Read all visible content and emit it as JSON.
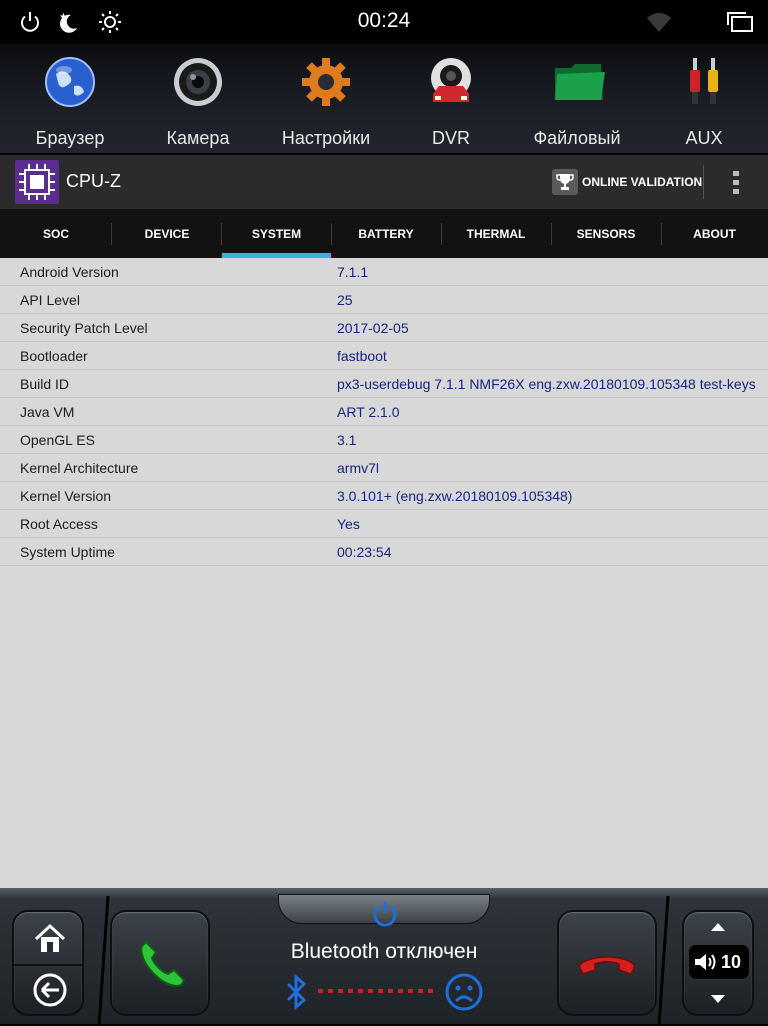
{
  "status_bar": {
    "time": "00:24",
    "icons": [
      "power-icon",
      "night-mode-icon",
      "brightness-icon",
      "wifi-icon",
      "recent-apps-icon"
    ]
  },
  "dock": {
    "apps": [
      {
        "label": "Браузер",
        "icon": "globe-icon"
      },
      {
        "label": "Камера",
        "icon": "camera-icon"
      },
      {
        "label": "Настройки",
        "icon": "gear-icon"
      },
      {
        "label": "DVR",
        "icon": "dvr-icon"
      },
      {
        "label": "Файловый",
        "icon": "folder-icon"
      },
      {
        "label": "AUX",
        "icon": "aux-icon"
      }
    ]
  },
  "app": {
    "title": "CPU-Z",
    "validation_label": "ONLINE VALIDATION",
    "accent": "#33b5e5",
    "logo_color": "#5b2d8e"
  },
  "tabs": [
    {
      "label": "SOC",
      "active": false
    },
    {
      "label": "DEVICE",
      "active": false
    },
    {
      "label": "SYSTEM",
      "active": true
    },
    {
      "label": "BATTERY",
      "active": false
    },
    {
      "label": "THERMAL",
      "active": false
    },
    {
      "label": "SENSORS",
      "active": false
    },
    {
      "label": "ABOUT",
      "active": false
    }
  ],
  "system_info": [
    {
      "key": "Android Version",
      "value": "7.1.1"
    },
    {
      "key": "API Level",
      "value": "25"
    },
    {
      "key": "Security Patch Level",
      "value": "2017-02-05"
    },
    {
      "key": "Bootloader",
      "value": "fastboot"
    },
    {
      "key": "Build ID",
      "value": "px3-userdebug 7.1.1 NMF26X eng.zxw.20180109.105348 test-keys"
    },
    {
      "key": "Java VM",
      "value": "ART 2.1.0"
    },
    {
      "key": "OpenGL ES",
      "value": "3.1"
    },
    {
      "key": "Kernel Architecture",
      "value": "armv7l"
    },
    {
      "key": "Kernel Version",
      "value": "3.0.101+ (eng.zxw.20180109.105348)"
    },
    {
      "key": "Root Access",
      "value": "Yes"
    },
    {
      "key": "System Uptime",
      "value": "00:23:54"
    }
  ],
  "car_bar": {
    "bluetooth_status": "Bluetooth отключен",
    "volume": "10",
    "icons": [
      "home-icon",
      "back-icon",
      "call-answer-icon",
      "power-icon",
      "bluetooth-icon",
      "sad-face-icon",
      "call-end-icon",
      "volume-up-arrow-icon",
      "speaker-icon",
      "volume-down-arrow-icon"
    ]
  }
}
